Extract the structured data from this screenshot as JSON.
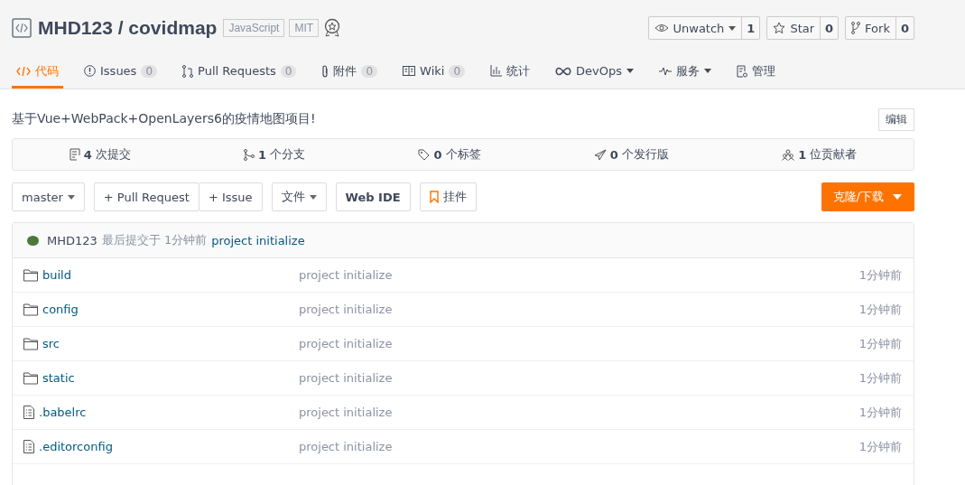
{
  "repo": {
    "owner": "MHD123",
    "separator": "/",
    "name": "covidmap",
    "tags": [
      "JavaScript",
      "MIT"
    ]
  },
  "actions": [
    {
      "label": "Unwatch",
      "dropdown": true,
      "count": "1"
    },
    {
      "label": "Star",
      "dropdown": false,
      "count": "0"
    },
    {
      "label": "Fork",
      "dropdown": false,
      "count": "0"
    }
  ],
  "tabs": [
    {
      "label": "代码",
      "selected": true,
      "dropdown": false
    },
    {
      "label": "Issues",
      "count": "0",
      "selected": false,
      "dropdown": false
    },
    {
      "label": "Pull Requests",
      "count": "0",
      "selected": false,
      "dropdown": false
    },
    {
      "label": "附件",
      "count": "0",
      "selected": false,
      "dropdown": false
    },
    {
      "label": "Wiki",
      "count": "0",
      "selected": false,
      "dropdown": false
    },
    {
      "label": "统计",
      "selected": false,
      "dropdown": false
    },
    {
      "label": "DevOps",
      "selected": false,
      "dropdown": true
    },
    {
      "label": "服务",
      "selected": false,
      "dropdown": true
    },
    {
      "label": "管理",
      "selected": false,
      "dropdown": false
    }
  ],
  "description": "基于Vue+WebPack+OpenLayers6的疫情地图项目!",
  "edit_button": "编辑",
  "stats": [
    {
      "count": "4",
      "label": "次提交"
    },
    {
      "count": "1",
      "label": "个分支"
    },
    {
      "count": "0",
      "label": "个标签"
    },
    {
      "count": "0",
      "label": "个发行版"
    },
    {
      "count": "1",
      "label": "位贡献者"
    }
  ],
  "toolbar": {
    "branch": "master",
    "pull_request": "+ Pull Request",
    "issue": "+ Issue",
    "file": "文件",
    "web_ide": "Web IDE",
    "widget": "挂件",
    "clone": "克隆/下载"
  },
  "last_commit": {
    "author": "MHD123",
    "meta": "最后提交于 1分钟前",
    "message": "project initialize"
  },
  "files": [
    {
      "kind": "folder",
      "name": "build",
      "message": "project initialize",
      "time": "1分钟前"
    },
    {
      "kind": "folder",
      "name": "config",
      "message": "project initialize",
      "time": "1分钟前"
    },
    {
      "kind": "folder",
      "name": "src",
      "message": "project initialize",
      "time": "1分钟前"
    },
    {
      "kind": "folder",
      "name": "static",
      "message": "project initialize",
      "time": "1分钟前"
    },
    {
      "kind": "file",
      "name": ".babelrc",
      "message": "project initialize",
      "time": "1分钟前"
    },
    {
      "kind": "file",
      "name": ".editorconfig",
      "message": "project initialize",
      "time": "1分钟前"
    }
  ]
}
